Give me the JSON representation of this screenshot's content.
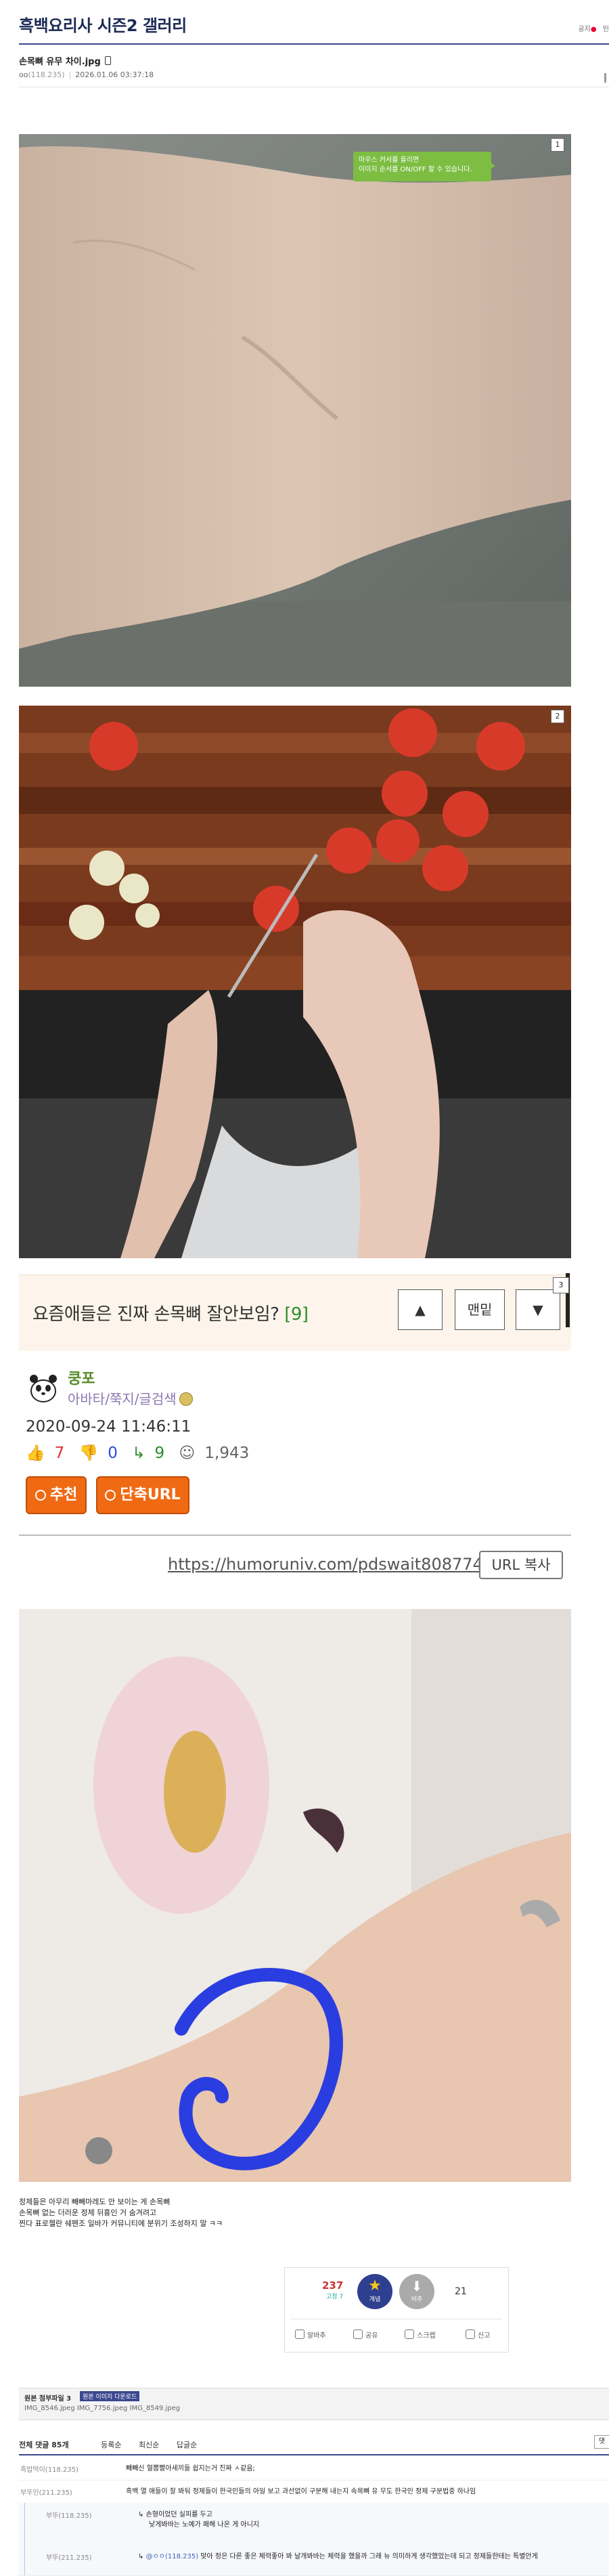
{
  "gallery": {
    "title": "흑백요리사 시즌2 갤러리",
    "links": [
      "공지",
      "인"
    ]
  },
  "post": {
    "title": "손목뼈 유무 차이.jpg",
    "author_icon": "oo",
    "ip": "(118.235)",
    "datetime": "2026.01.06 03:37:18"
  },
  "images": {
    "img1_num": "1",
    "img2_num": "2",
    "tip_line1": "마우스 커서를 올리면",
    "tip_line2": "이미지 순서를 ON/OFF 할 수 있습니다."
  },
  "humoruniv": {
    "title": "요즘애들은 진짜 손목뼈 잘안보임?",
    "count": "[9]",
    "btn_up": "▲",
    "btn_top": "맨밑",
    "btn_down": "▼",
    "side_num": "3",
    "author": "쿵포",
    "author_sub": "아바타/쭉지/글검색",
    "date": "2020-09-24 11:46:11",
    "likes": "7",
    "dislikes": "0",
    "replies": "9",
    "views": "1,943",
    "recommend_label": "추천",
    "short_url_label": "단축URL",
    "url": "https://humoruniv.com/pdswait8087740",
    "url_copy_label": "URL 복사"
  },
  "body": {
    "line1": "정제들은 아무리 빼빼마레도 안 보이는 게 손목뼈",
    "line2": "손목뼈 없는 더러운 정제 뒤흉인 거 숨겨려고",
    "line3": "찐다 표로젤란 쉐펜조 일바가 커뮤니티에 분위기 조성하지 말 ㅋㅋ"
  },
  "vote": {
    "up_count": "237",
    "up_sub": "고정 7",
    "star_label": "개념",
    "down_label": "비추",
    "down_count": "21",
    "actions": [
      "알바추",
      "공유",
      "스크랩",
      "신고"
    ]
  },
  "attachments": {
    "label": "원본 첨부파일 3",
    "badge": "원본 이미지 다운로드",
    "files": "IMG_8546.jpeg  IMG_7756.jpeg  IMG_8549.jpeg"
  },
  "comments": {
    "tabs": [
      "전체 댓글 85개",
      "등록순",
      "최신순",
      "답글순"
    ],
    "side": "댓",
    "rows": [
      {
        "nick": "흑밥먹이(118.235)",
        "text": "빼빼신 혈뽑빨아세끼들 쉽지는거 진짜 ㅅ같음;"
      },
      {
        "nick": "부뚜인(211.235)",
        "text": "흑백 열 애들이 잘 봐둬 정제들이 한국인들의 아일 보고 과선없이 구분해 내는지 속목뼈 유 무도 한국인 정제 구분법중 하나임"
      },
      {
        "nick": "부뚜(118.235)",
        "text": "손형이었던 실피를 두고",
        "text2": "낮게봐바는 노예가 패해 나온 게 아니지"
      },
      {
        "nick": "부뚜(211.235)",
        "reply": "@ㅇㅇ(118.235)",
        "text": "맞아 정은 다른 좋은 체력좋아 봐 날개봐바는 체력을 했을까 그래 뉴 의미하게 생각했었는데 되고 정제들한테는 특별안게"
      }
    ]
  }
}
